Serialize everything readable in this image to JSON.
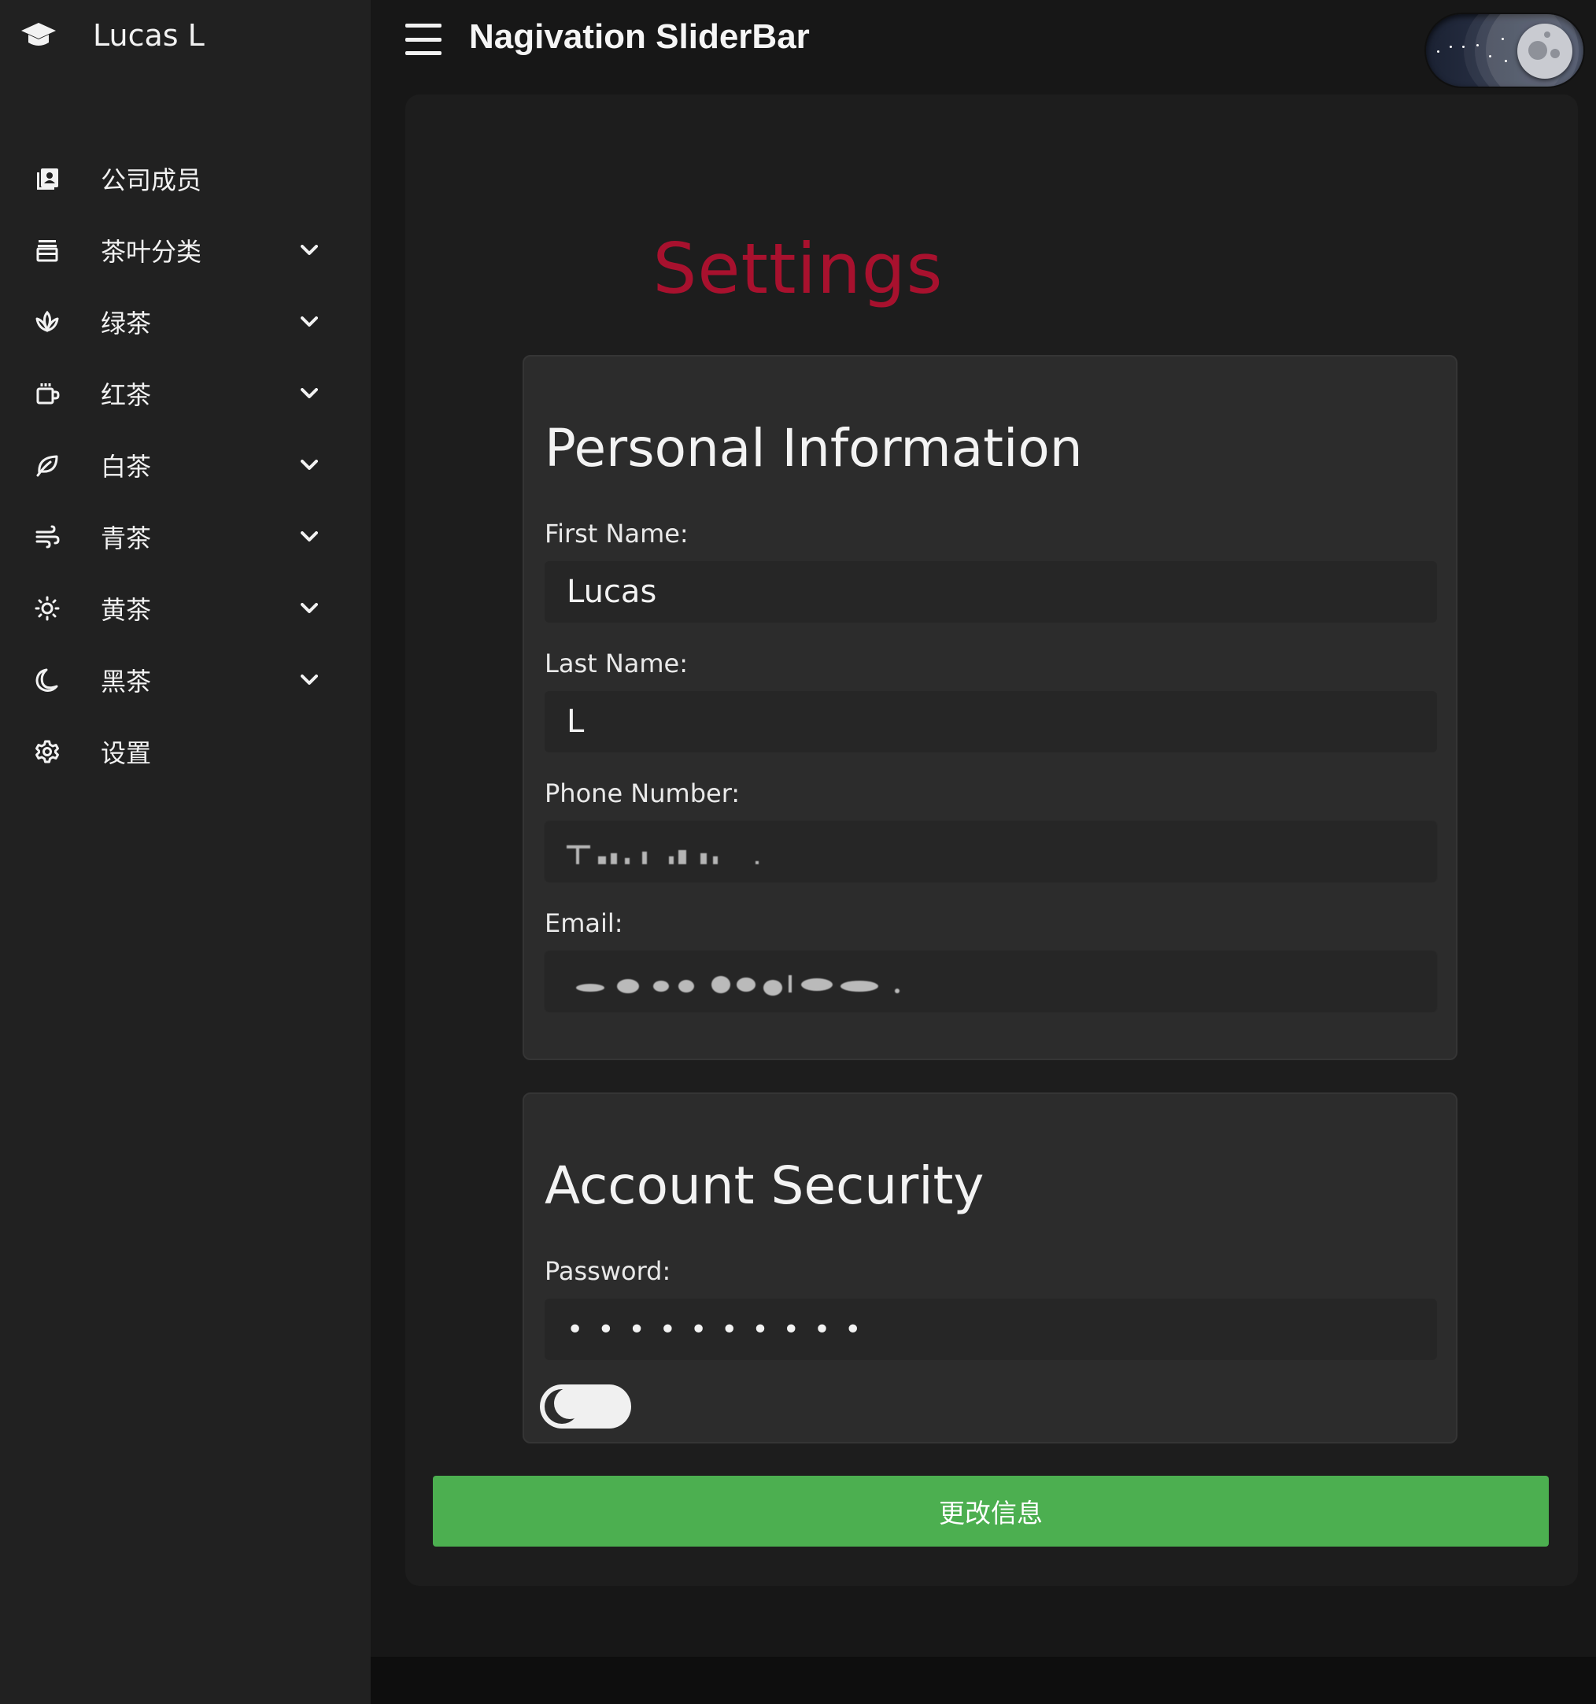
{
  "sidebar": {
    "user_name": "Lucas L",
    "items": [
      {
        "label": "公司成员",
        "icon": "contact-book-icon",
        "expandable": false
      },
      {
        "label": "茶叶分类",
        "icon": "tea-box-icon",
        "expandable": true
      },
      {
        "label": "绿茶",
        "icon": "lotus-icon",
        "expandable": true
      },
      {
        "label": "红茶",
        "icon": "mug-icon",
        "expandable": true
      },
      {
        "label": "白茶",
        "icon": "leaf-icon",
        "expandable": true
      },
      {
        "label": "青茶",
        "icon": "wind-icon",
        "expandable": true
      },
      {
        "label": "黄茶",
        "icon": "sun-icon",
        "expandable": true
      },
      {
        "label": "黑茶",
        "icon": "moon-icon",
        "expandable": true
      },
      {
        "label": "设置",
        "icon": "gear-icon",
        "expandable": false
      }
    ]
  },
  "header": {
    "title": "Nagivation SliderBar",
    "theme_toggle": "dark"
  },
  "page": {
    "title": "Settings",
    "title_color": "#a8112e"
  },
  "personal": {
    "heading": "Personal Information",
    "first_name_label": "First Name:",
    "first_name_value": "Lucas",
    "last_name_label": "Last Name:",
    "last_name_value": "L",
    "phone_label": "Phone Number:",
    "email_label": "Email:"
  },
  "security": {
    "heading": "Account Security",
    "password_label": "Password:",
    "password_value": "••••••••••"
  },
  "submit_label": "更改信息",
  "colors": {
    "accent_green": "#4caf50",
    "sidebar_bg": "#212121",
    "card_bg": "#2c2c2c"
  }
}
